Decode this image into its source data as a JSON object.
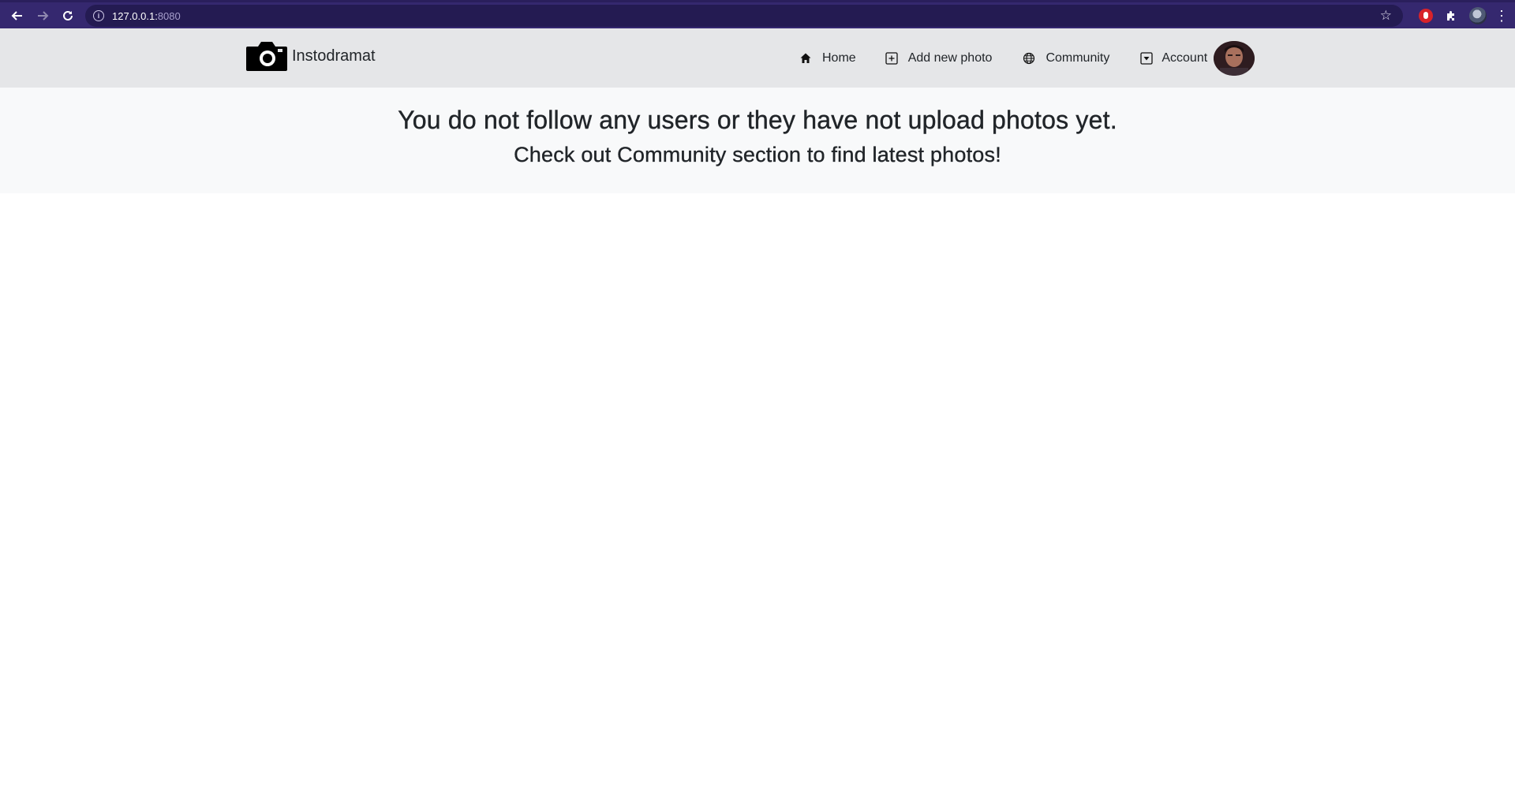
{
  "browser": {
    "url_host": "127.0.0.1:",
    "url_port": "8080",
    "theme_color": "#35286f"
  },
  "navbar": {
    "brand": "Instodramat",
    "links": {
      "home": "Home",
      "add_photo": "Add new photo",
      "community": "Community",
      "account": "Account"
    },
    "background": "#e5e6e8"
  },
  "banner": {
    "title": "You do not follow any users or they have not upload photos yet.",
    "subtitle": "Check out Community section to find latest photos!"
  }
}
